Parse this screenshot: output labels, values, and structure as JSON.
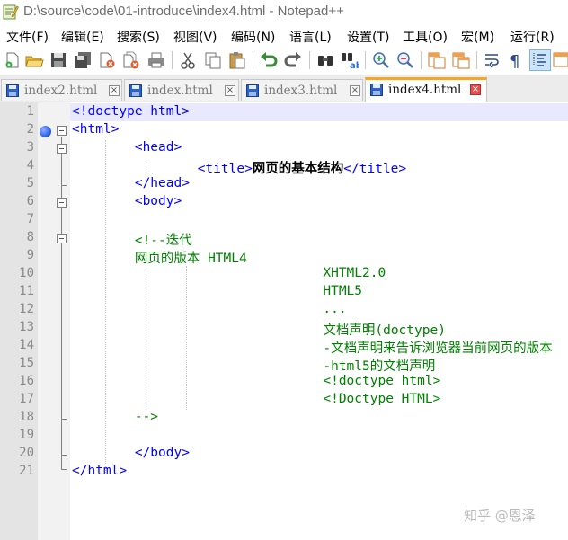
{
  "window": {
    "title": "D:\\source\\code\\01-introduce\\index4.html - Notepad++"
  },
  "menu": [
    {
      "label": "文件(F)"
    },
    {
      "label": "编辑(E)"
    },
    {
      "label": "搜索(S)"
    },
    {
      "label": "视图(V)"
    },
    {
      "label": "编码(N)"
    },
    {
      "label": "语言(L)"
    },
    {
      "label": "设置(T)"
    },
    {
      "label": "工具(O)"
    },
    {
      "label": "宏(M)"
    },
    {
      "label": "运行(R)"
    }
  ],
  "toolbar": {
    "icons": [
      "new-file-icon",
      "open-folder-icon",
      "save-icon",
      "save-all-icon",
      "close-icon",
      "close-all-icon",
      "print-icon",
      "cut-icon",
      "copy-icon",
      "paste-icon",
      "undo-icon",
      "redo-icon",
      "find-icon",
      "replace-icon",
      "zoom-in-icon",
      "zoom-out-icon",
      "sync-vertical-icon",
      "sync-horizontal-icon",
      "word-wrap-icon",
      "show-all-chars-icon",
      "indent-guide-icon",
      "doc-map-icon"
    ]
  },
  "tabs": [
    {
      "label": "index2.html",
      "active": false
    },
    {
      "label": "index.html",
      "active": false
    },
    {
      "label": "index3.html",
      "active": false
    },
    {
      "label": "index4.html",
      "active": true
    }
  ],
  "editor": {
    "lines": [
      {
        "num": "1",
        "segments": [
          {
            "t": "<!doctype html>",
            "c": "tag"
          }
        ]
      },
      {
        "num": "2",
        "segments": [
          {
            "t": "<html>",
            "c": "tag"
          }
        ]
      },
      {
        "num": "3",
        "segments": [
          {
            "t": "\t<head>",
            "c": "tag"
          }
        ]
      },
      {
        "num": "4",
        "segments": [
          {
            "t": "\t\t<title>",
            "c": "tag"
          },
          {
            "t": "网页的基本结构",
            "c": "bold"
          },
          {
            "t": "</title>",
            "c": "tag"
          }
        ]
      },
      {
        "num": "5",
        "segments": [
          {
            "t": "\t</head>",
            "c": "tag"
          }
        ]
      },
      {
        "num": "6",
        "segments": [
          {
            "t": "\t<body>",
            "c": "tag"
          }
        ]
      },
      {
        "num": "7",
        "segments": []
      },
      {
        "num": "8",
        "segments": [
          {
            "t": "\t<!--迭代",
            "c": "cmt"
          }
        ]
      },
      {
        "num": "9",
        "segments": [
          {
            "t": "\t网页的版本 HTML4",
            "c": "cmt"
          }
        ]
      },
      {
        "num": "10",
        "segments": [
          {
            "t": "\t\t\t\tXHTML2.0",
            "c": "cmt"
          }
        ]
      },
      {
        "num": "11",
        "segments": [
          {
            "t": "\t\t\t\tHTML5",
            "c": "cmt"
          }
        ]
      },
      {
        "num": "12",
        "segments": [
          {
            "t": "\t\t\t\t...",
            "c": "cmt"
          }
        ]
      },
      {
        "num": "13",
        "segments": [
          {
            "t": "\t\t\t\t文档声明(doctype)",
            "c": "cmt"
          }
        ]
      },
      {
        "num": "14",
        "segments": [
          {
            "t": "\t\t\t\t-文档声明来告诉浏览器当前网页的版本",
            "c": "cmt"
          }
        ]
      },
      {
        "num": "15",
        "segments": [
          {
            "t": "\t\t\t\t-html5的文档声明",
            "c": "cmt"
          }
        ]
      },
      {
        "num": "16",
        "segments": [
          {
            "t": "\t\t\t\t<!doctype html>",
            "c": "cmt"
          }
        ]
      },
      {
        "num": "17",
        "segments": [
          {
            "t": "\t\t\t\t<!Doctype HTML>",
            "c": "cmt"
          }
        ]
      },
      {
        "num": "18",
        "segments": [
          {
            "t": "\t-->",
            "c": "cmt"
          }
        ]
      },
      {
        "num": "19",
        "segments": []
      },
      {
        "num": "20",
        "segments": [
          {
            "t": "\t</body>",
            "c": "tag"
          }
        ]
      },
      {
        "num": "21",
        "segments": [
          {
            "t": "</html>",
            "c": "tag"
          }
        ]
      }
    ]
  },
  "watermark": "知乎 @恩泽",
  "colors": {
    "tag": "#0000ff",
    "comment": "#008000",
    "text_bold": "#000000",
    "active_tab_accent": "#f5a623",
    "bookmark": "#2255dd"
  }
}
